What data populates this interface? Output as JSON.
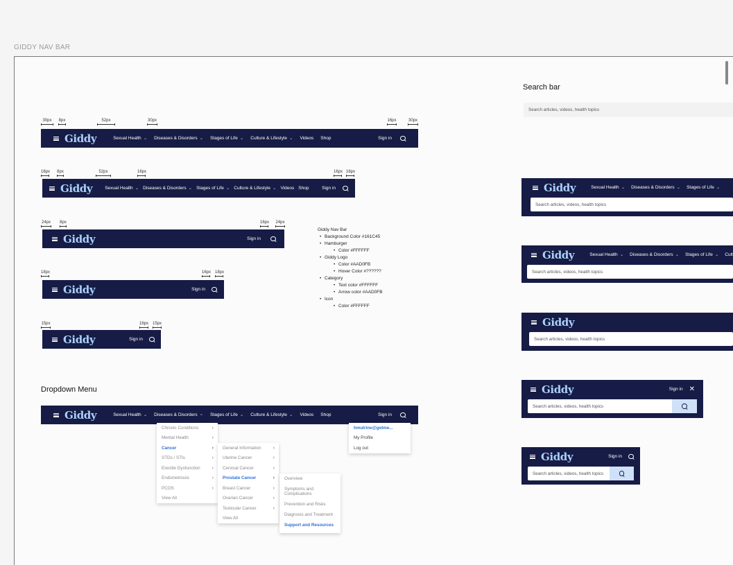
{
  "frame_label": "GIDDY NAV BAR",
  "brand": {
    "logo": "Giddy",
    "colors": {
      "nav_bg": "#161C45",
      "logo": "#AAD0FB",
      "text": "#FFFFFF",
      "link": "#2f6fd6"
    }
  },
  "nav": {
    "categories": [
      "Sexual Health",
      "Diseases & Disorders",
      "Stages of Life",
      "Culture & Lifestyle",
      "Videos",
      "Shop"
    ],
    "sign_in": "Sign in"
  },
  "measurements": {
    "v1": [
      "30px",
      "8px",
      "52px",
      "30px",
      "16px",
      "30px"
    ],
    "v2": [
      "16px",
      "8px",
      "52px",
      "16px",
      "16px",
      "16px"
    ],
    "v3": [
      "24px",
      "8px",
      "16px",
      "24px"
    ],
    "v4": [
      "18px",
      "16px",
      "18px"
    ],
    "v5": [
      "15px",
      "16px",
      "15px"
    ]
  },
  "notes": {
    "title": "Giddy Nav Bar",
    "items": [
      {
        "label": "Background Color #161C45",
        "sub": []
      },
      {
        "label": "Hamburger",
        "sub": [
          "Color #FFFFFF"
        ]
      },
      {
        "label": "Giddy Logo",
        "sub": [
          "Color #AAD0FB",
          "Hover Color #??????"
        ]
      },
      {
        "label": "Category",
        "sub": [
          "Text color #FFFFFF",
          "Arrow color #AAD0FB"
        ]
      },
      {
        "label": "Icon",
        "sub": [
          "Color #FFFFFF"
        ]
      }
    ]
  },
  "search_section": {
    "title": "Search bar",
    "placeholder": "Search articles, videos, health topics"
  },
  "dropdown_section": {
    "title": "Dropdown Menu",
    "level1": [
      {
        "label": "Chronic Conditions",
        "chev": "›",
        "active": false
      },
      {
        "label": "Mental Health",
        "chev": "›",
        "active": false
      },
      {
        "label": "Cancer",
        "chev": "›",
        "active": true
      },
      {
        "label": "STDs / STIs",
        "chev": "›",
        "active": false
      },
      {
        "label": "Erectile Dysfunction",
        "chev": "›",
        "active": false
      },
      {
        "label": "Endometriosis",
        "chev": "›",
        "active": false
      },
      {
        "label": "PCOS",
        "chev": "›",
        "active": false
      },
      {
        "label": "View All",
        "chev": "",
        "active": false
      }
    ],
    "level2": [
      {
        "label": "General Information",
        "chev": "›",
        "active": false
      },
      {
        "label": "Uterine Cancer",
        "chev": "›",
        "active": false
      },
      {
        "label": "Cervical Cancer",
        "chev": "›",
        "active": false
      },
      {
        "label": "Prostate Cancer",
        "chev": "›",
        "active": true
      },
      {
        "label": "Breast Cancer",
        "chev": "›",
        "active": false
      },
      {
        "label": "Ovarian Cancer",
        "chev": "›",
        "active": false
      },
      {
        "label": "Testicular Cancer",
        "chev": "›",
        "active": false
      },
      {
        "label": "View All",
        "chev": "",
        "active": false
      }
    ],
    "level3": [
      {
        "label": "Overview",
        "active": false
      },
      {
        "label": "Symptoms and Complications",
        "active": false
      },
      {
        "label": "Prevention and Risks",
        "active": false
      },
      {
        "label": "Diagnosis and Treatment",
        "active": false
      },
      {
        "label": "Support and Resources",
        "active": true
      }
    ],
    "user_menu": [
      "hmulrine@getme...",
      "My Profile",
      "Log out"
    ]
  },
  "icons": {
    "menu": "hamburger-icon",
    "search": "search-icon",
    "close": "close-icon",
    "dropdown": "chevron-down-icon",
    "dropdown_open": "chevron-up-icon"
  }
}
